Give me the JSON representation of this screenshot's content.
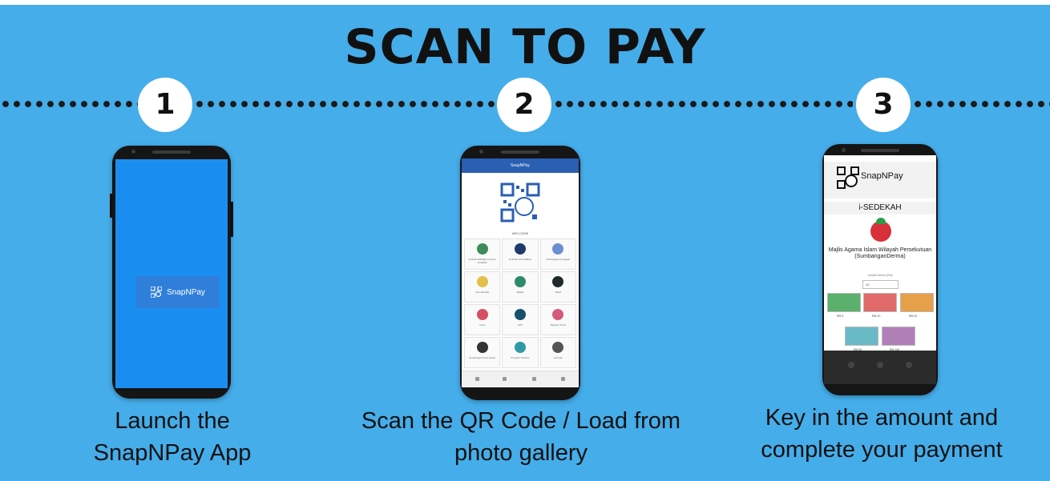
{
  "title": "SCAN TO PAY",
  "steps": [
    {
      "number": "1",
      "caption_line1": "Launch the",
      "caption_line2": "SnapNPay App"
    },
    {
      "number": "2",
      "caption_line1": "Scan the QR Code / Load from",
      "caption_line2": "photo gallery"
    },
    {
      "number": "3",
      "caption_line1": "Key in the amount and",
      "caption_line2": "complete your payment"
    }
  ],
  "screen1": {
    "splash_label": "SnapNPay"
  },
  "screen2": {
    "topbar": "SnapNPay",
    "welcome": "WELCOME",
    "tiles": [
      {
        "label": "Institution/Masjid & Surau Terdaftar",
        "color": "#3c8d5a"
      },
      {
        "label": "Institution Pendidikan",
        "color": "#1f3a6b"
      },
      {
        "label": "NGO/Agensi Kerajaan",
        "color": "#6b8fd0"
      },
      {
        "label": "Derma/Infaq",
        "color": "#e3c04a"
      },
      {
        "label": "Wakaf",
        "color": "#2e8a6d"
      },
      {
        "label": "Zakat",
        "color": "#1f2b2b"
      },
      {
        "label": "Yuran",
        "color": "#d44f5f"
      },
      {
        "label": "eWT",
        "color": "#16506b"
      },
      {
        "label": "Bayaran Terus",
        "color": "#d65a7a"
      },
      {
        "label": "Sumbangan Kecemasan",
        "color": "#333333"
      },
      {
        "label": "Program Tertentu",
        "color": "#2e9aa5"
      },
      {
        "label": "Lain-lain",
        "color": "#555555"
      }
    ]
  },
  "screen3": {
    "brand": "SnapNPay",
    "program": "i-SEDEKAH",
    "organization": "Majlis Agama Islam Wilayah Persekutuan (SumbanganDerma)",
    "amount_label": "Jumlah Derma (RM)",
    "amount_value": "10",
    "notes": [
      {
        "label": "RM 5",
        "color": "#5bb06b"
      },
      {
        "label": "RM 10",
        "color": "#e06a6a"
      },
      {
        "label": "RM 20",
        "color": "#e6a04a"
      },
      {
        "label": "RM 50",
        "color": "#6ab9c7"
      },
      {
        "label": "RM 100",
        "color": "#b07fb8"
      }
    ]
  }
}
